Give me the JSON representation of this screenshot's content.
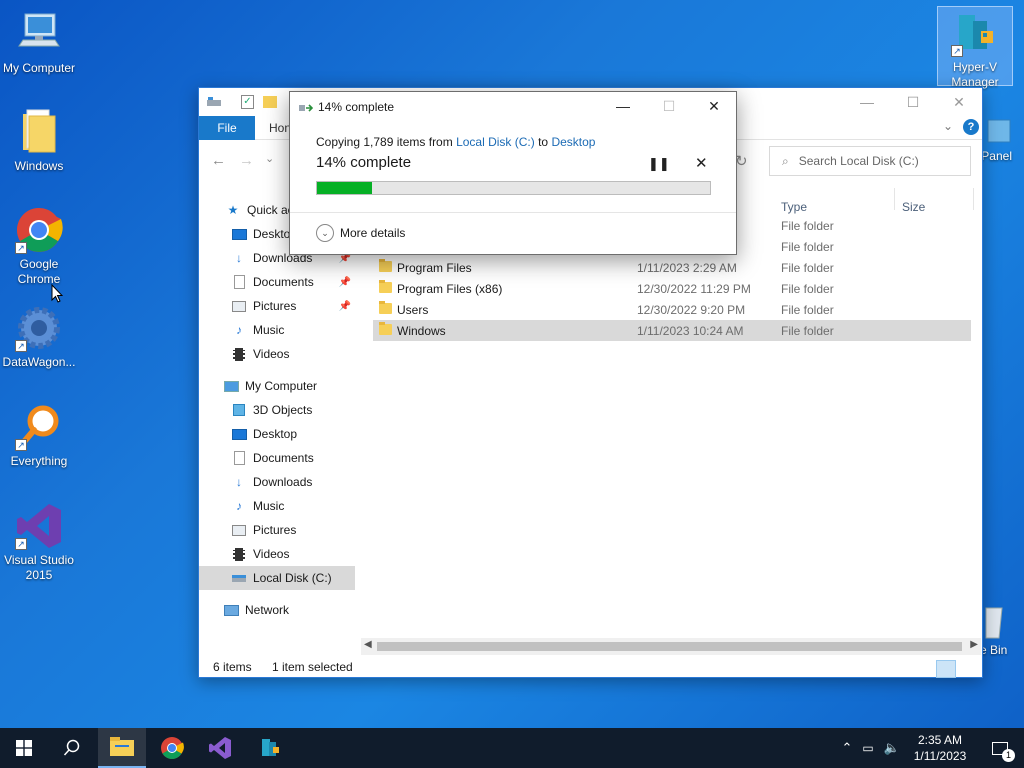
{
  "desktop": {
    "icons": [
      {
        "label": "My Computer"
      },
      {
        "label": "Windows"
      },
      {
        "label": "Google Chrome"
      },
      {
        "label": "DataWagon..."
      },
      {
        "label": "Everything"
      },
      {
        "label": "Visual Studio 2015"
      }
    ],
    "hyperv_label": "Hyper-V Manager",
    "control_panel_partial": "Panel",
    "recycle_partial": "e Bin"
  },
  "explorer": {
    "file_tab": "File",
    "home_tab": "Hon",
    "search_placeholder": "Search Local Disk (C:)",
    "columns": {
      "type": "Type",
      "size": "Size"
    },
    "nav": {
      "quick_access": "Quick ac",
      "quick_items": [
        {
          "label": "Deskto"
        },
        {
          "label": "Downloads"
        },
        {
          "label": "Documents"
        },
        {
          "label": "Pictures"
        },
        {
          "label": "Music"
        },
        {
          "label": "Videos"
        }
      ],
      "my_computer": "My Computer",
      "computer_items": [
        {
          "label": "3D Objects"
        },
        {
          "label": "Desktop"
        },
        {
          "label": "Documents"
        },
        {
          "label": "Downloads"
        },
        {
          "label": "Music"
        },
        {
          "label": "Pictures"
        },
        {
          "label": "Videos"
        },
        {
          "label": "Local Disk (C:)"
        }
      ],
      "network": "Network"
    },
    "files": [
      {
        "name": "",
        "date": "",
        "type": "File folder"
      },
      {
        "name": "",
        "date": "",
        "type": "File folder"
      },
      {
        "name": "Program Files",
        "date": "1/11/2023 2:29 AM",
        "type": "File folder"
      },
      {
        "name": "Program Files (x86)",
        "date": "12/30/2022 11:29 PM",
        "type": "File folder"
      },
      {
        "name": "Users",
        "date": "12/30/2022 9:20 PM",
        "type": "File folder"
      },
      {
        "name": "Windows",
        "date": "1/11/2023 10:24 AM",
        "type": "File folder"
      }
    ],
    "status": {
      "items": "6 items",
      "selected": "1 item selected"
    }
  },
  "copy_dialog": {
    "title": "14% complete",
    "copying_prefix": "Copying 1,789 items from ",
    "source": "Local Disk (C:)",
    "to_word": " to ",
    "destination": "Desktop",
    "percent_text": "14% complete",
    "progress": 0.14,
    "more_details": "More details",
    "progress_color": "#06b025"
  },
  "taskbar": {
    "time": "2:35 AM",
    "date": "1/11/2023",
    "notification_count": "1"
  },
  "colors": {
    "accent": "#1979ca",
    "link": "#1c6bb5"
  }
}
